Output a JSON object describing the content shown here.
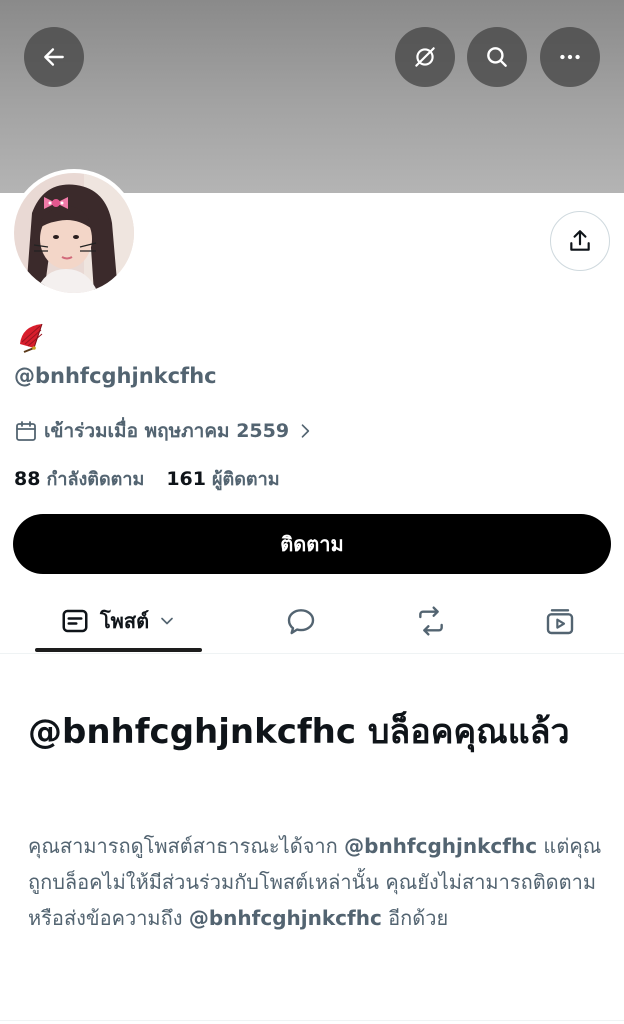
{
  "header": {
    "back_icon": "arrow-left-icon",
    "grok_icon": "slash-circle-icon",
    "search_icon": "search-icon",
    "more_icon": "more-horizontal-icon",
    "share_icon": "share-upload-icon"
  },
  "profile": {
    "emoji": "🪭",
    "handle": "@bnhfcghjnkcfhc",
    "joined": "เข้าร่วมเมื่อ พฤษภาคม 2559",
    "following_count": "88",
    "following_label": "กำลังติดตาม",
    "followers_count": "161",
    "followers_label": "ผู้ติดตาม",
    "follow_button": "ติดตาม"
  },
  "tabs": {
    "posts_label": "โพสต์"
  },
  "blocked": {
    "title": "@bnhfcghjnkcfhc บล็อคคุณแล้ว",
    "desc_part1": "คุณสามารถดูโพสต์สาธารณะได้จาก ",
    "desc_handle1": "@bnhfcghjnkcfhc",
    "desc_part2": " แต่คุณถูกบล็อคไม่ให้มีส่วนร่วมกับโพสต์เหล่านั้น คุณยังไม่สามารถติดตามหรือส่งข้อความถึง ",
    "desc_handle2": "@bnhfcghjnkcfhc",
    "desc_part3": " อีกด้วย"
  },
  "colors": {
    "text_primary": "#0f1419",
    "text_secondary": "#536471",
    "button_bg": "#000000",
    "border": "#cfd9de"
  }
}
